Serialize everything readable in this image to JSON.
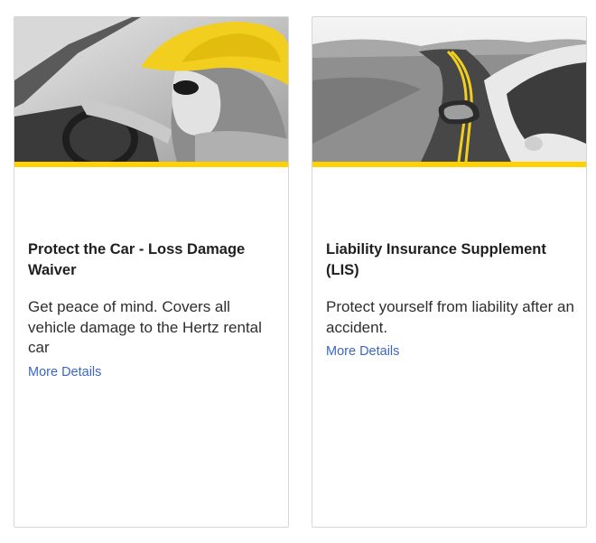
{
  "colors": {
    "accent_yellow": "#ffd100",
    "link_blue": "#3b66c4",
    "text_dark": "#1f1f1f",
    "card_border": "#d6d6d6"
  },
  "cards": [
    {
      "image_icon": "woman-in-yellow-hat-driving-photo",
      "title": "Protect the Car - Loss Damage Waiver",
      "description": "Get peace of mind. Covers all vehicle damage to the Hertz rental car",
      "link_label": "More Details"
    },
    {
      "image_icon": "open-road-with-car-mirror-photo",
      "title": "Liability Insurance Supplement (LIS)",
      "description": "Protect yourself from liability after an accident.",
      "link_label": "More Details"
    }
  ]
}
